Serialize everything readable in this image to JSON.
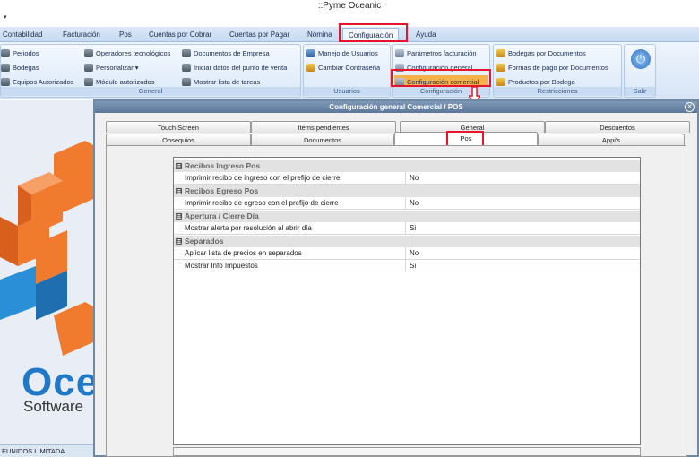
{
  "window": {
    "title": "::Pyme Oceanic",
    "qat_label": "▾"
  },
  "menu": {
    "items": [
      "Contabilidad",
      "Facturación",
      "Pos",
      "Cuentas por Cobrar",
      "Cuentas por Pagar",
      "Nómina",
      "Configuración",
      "Ayuda"
    ],
    "active": "Configuración"
  },
  "ribbon": {
    "general": {
      "label": "General",
      "items": [
        "Periodos",
        "Bodegas",
        "Equipos Autorizados",
        "Operadores tecnológicos",
        "Personalizar",
        "Módulo autorizados",
        "Documentos de Empresa",
        "Iniciar datos del punto de venta",
        "Mostrar lista de tareas"
      ],
      "personalizar_caret": "▾"
    },
    "usuarios": {
      "label": "Usuarios",
      "items": [
        "Manejo de Usuarios",
        "Cambiar Contraseña"
      ]
    },
    "configuracion": {
      "label": "Configuración",
      "items": [
        "Parámetros facturación",
        "Configuración general",
        "Configuración comercial"
      ]
    },
    "restricciones": {
      "label": "Restricciones",
      "items": [
        "Bodegas por Documentos",
        "Formas de pago por Documentos",
        "Productos por Bodega"
      ]
    },
    "salir": {
      "label": "Salir",
      "icon": "power-icon"
    }
  },
  "background": {
    "brand": "Oce",
    "brand_sub": "Software",
    "status": "EUNIDOS LIMITADA"
  },
  "dialog": {
    "title": "Configuración general Comercial / POS",
    "close": "✕",
    "tabs_row1": [
      "Touch Screen",
      "ítems pendientes",
      "General",
      "Descuentos"
    ],
    "tabs_row2": [
      "Obsequios",
      "Documentos",
      "Pos",
      "Appi's"
    ],
    "active_tab": "Pos",
    "categories": [
      {
        "name": "Recibos Ingreso Pos",
        "toggle": "⊟",
        "rows": [
          {
            "key": "Imprimir recibo de ingreso con el prefijo de cierre",
            "value": "No"
          }
        ]
      },
      {
        "name": "Recibos Egreso Pos",
        "toggle": "⊟",
        "rows": [
          {
            "key": "Imprimir recibo de egreso con el prefijo de cierre",
            "value": "No"
          }
        ]
      },
      {
        "name": "Apertura / Cierre Día",
        "toggle": "⊟",
        "rows": [
          {
            "key": "Mostrar alerta por resolución al abrir día",
            "value": "Si"
          }
        ]
      },
      {
        "name": "Separados",
        "toggle": "⊟",
        "rows": [
          {
            "key": "Aplicar lista de precios en separados",
            "value": "No"
          },
          {
            "key": "Mostrar Info Impuestos",
            "value": "Si"
          }
        ]
      }
    ]
  },
  "colors": {
    "highlight": "#e8142c",
    "accent": "#1f78c8",
    "cube": "#f07a2e"
  }
}
